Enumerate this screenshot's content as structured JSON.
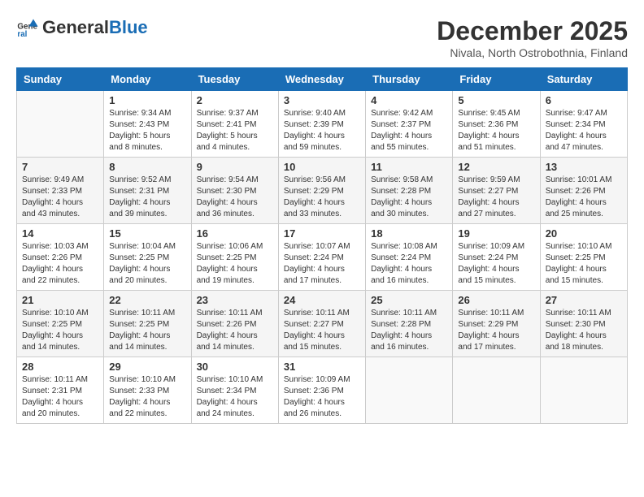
{
  "logo": {
    "line1": "General",
    "line2": "Blue"
  },
  "title": "December 2025",
  "subtitle": "Nivala, North Ostrobothnia, Finland",
  "days_of_week": [
    "Sunday",
    "Monday",
    "Tuesday",
    "Wednesday",
    "Thursday",
    "Friday",
    "Saturday"
  ],
  "weeks": [
    [
      {
        "day": "",
        "info": ""
      },
      {
        "day": "1",
        "info": "Sunrise: 9:34 AM\nSunset: 2:43 PM\nDaylight: 5 hours\nand 8 minutes."
      },
      {
        "day": "2",
        "info": "Sunrise: 9:37 AM\nSunset: 2:41 PM\nDaylight: 5 hours\nand 4 minutes."
      },
      {
        "day": "3",
        "info": "Sunrise: 9:40 AM\nSunset: 2:39 PM\nDaylight: 4 hours\nand 59 minutes."
      },
      {
        "day": "4",
        "info": "Sunrise: 9:42 AM\nSunset: 2:37 PM\nDaylight: 4 hours\nand 55 minutes."
      },
      {
        "day": "5",
        "info": "Sunrise: 9:45 AM\nSunset: 2:36 PM\nDaylight: 4 hours\nand 51 minutes."
      },
      {
        "day": "6",
        "info": "Sunrise: 9:47 AM\nSunset: 2:34 PM\nDaylight: 4 hours\nand 47 minutes."
      }
    ],
    [
      {
        "day": "7",
        "info": "Sunrise: 9:49 AM\nSunset: 2:33 PM\nDaylight: 4 hours\nand 43 minutes."
      },
      {
        "day": "8",
        "info": "Sunrise: 9:52 AM\nSunset: 2:31 PM\nDaylight: 4 hours\nand 39 minutes."
      },
      {
        "day": "9",
        "info": "Sunrise: 9:54 AM\nSunset: 2:30 PM\nDaylight: 4 hours\nand 36 minutes."
      },
      {
        "day": "10",
        "info": "Sunrise: 9:56 AM\nSunset: 2:29 PM\nDaylight: 4 hours\nand 33 minutes."
      },
      {
        "day": "11",
        "info": "Sunrise: 9:58 AM\nSunset: 2:28 PM\nDaylight: 4 hours\nand 30 minutes."
      },
      {
        "day": "12",
        "info": "Sunrise: 9:59 AM\nSunset: 2:27 PM\nDaylight: 4 hours\nand 27 minutes."
      },
      {
        "day": "13",
        "info": "Sunrise: 10:01 AM\nSunset: 2:26 PM\nDaylight: 4 hours\nand 25 minutes."
      }
    ],
    [
      {
        "day": "14",
        "info": "Sunrise: 10:03 AM\nSunset: 2:26 PM\nDaylight: 4 hours\nand 22 minutes."
      },
      {
        "day": "15",
        "info": "Sunrise: 10:04 AM\nSunset: 2:25 PM\nDaylight: 4 hours\nand 20 minutes."
      },
      {
        "day": "16",
        "info": "Sunrise: 10:06 AM\nSunset: 2:25 PM\nDaylight: 4 hours\nand 19 minutes."
      },
      {
        "day": "17",
        "info": "Sunrise: 10:07 AM\nSunset: 2:24 PM\nDaylight: 4 hours\nand 17 minutes."
      },
      {
        "day": "18",
        "info": "Sunrise: 10:08 AM\nSunset: 2:24 PM\nDaylight: 4 hours\nand 16 minutes."
      },
      {
        "day": "19",
        "info": "Sunrise: 10:09 AM\nSunset: 2:24 PM\nDaylight: 4 hours\nand 15 minutes."
      },
      {
        "day": "20",
        "info": "Sunrise: 10:10 AM\nSunset: 2:25 PM\nDaylight: 4 hours\nand 15 minutes."
      }
    ],
    [
      {
        "day": "21",
        "info": "Sunrise: 10:10 AM\nSunset: 2:25 PM\nDaylight: 4 hours\nand 14 minutes."
      },
      {
        "day": "22",
        "info": "Sunrise: 10:11 AM\nSunset: 2:25 PM\nDaylight: 4 hours\nand 14 minutes."
      },
      {
        "day": "23",
        "info": "Sunrise: 10:11 AM\nSunset: 2:26 PM\nDaylight: 4 hours\nand 14 minutes."
      },
      {
        "day": "24",
        "info": "Sunrise: 10:11 AM\nSunset: 2:27 PM\nDaylight: 4 hours\nand 15 minutes."
      },
      {
        "day": "25",
        "info": "Sunrise: 10:11 AM\nSunset: 2:28 PM\nDaylight: 4 hours\nand 16 minutes."
      },
      {
        "day": "26",
        "info": "Sunrise: 10:11 AM\nSunset: 2:29 PM\nDaylight: 4 hours\nand 17 minutes."
      },
      {
        "day": "27",
        "info": "Sunrise: 10:11 AM\nSunset: 2:30 PM\nDaylight: 4 hours\nand 18 minutes."
      }
    ],
    [
      {
        "day": "28",
        "info": "Sunrise: 10:11 AM\nSunset: 2:31 PM\nDaylight: 4 hours\nand 20 minutes."
      },
      {
        "day": "29",
        "info": "Sunrise: 10:10 AM\nSunset: 2:33 PM\nDaylight: 4 hours\nand 22 minutes."
      },
      {
        "day": "30",
        "info": "Sunrise: 10:10 AM\nSunset: 2:34 PM\nDaylight: 4 hours\nand 24 minutes."
      },
      {
        "day": "31",
        "info": "Sunrise: 10:09 AM\nSunset: 2:36 PM\nDaylight: 4 hours\nand 26 minutes."
      },
      {
        "day": "",
        "info": ""
      },
      {
        "day": "",
        "info": ""
      },
      {
        "day": "",
        "info": ""
      }
    ]
  ]
}
